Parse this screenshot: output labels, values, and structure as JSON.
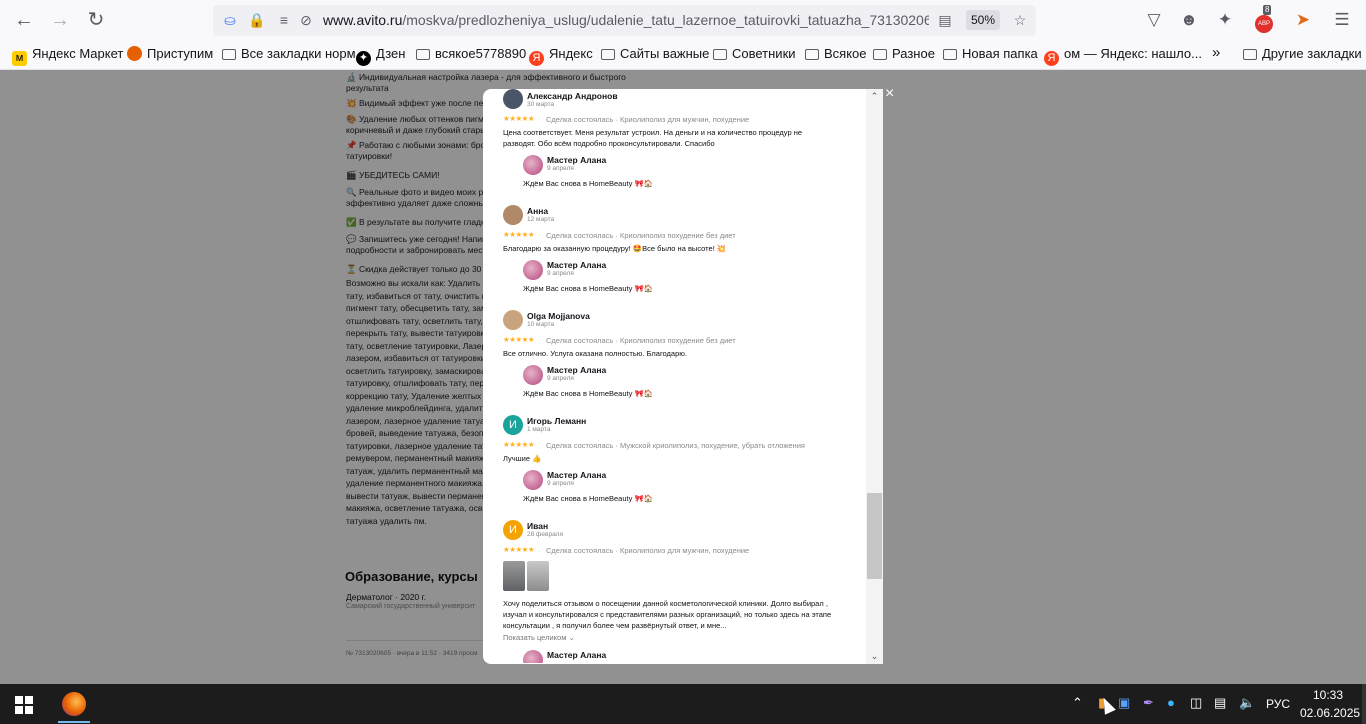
{
  "browser": {
    "url_host": "www.avito.ru",
    "url_path": "/moskva/predlozheniya_uslug/udalenie_tatu_lazernoe_tatuirovki_tatuazha_7313020605",
    "zoom": "50%",
    "notification_badge": "8",
    "badge_text": "ABP"
  },
  "bookmarks": [
    {
      "label": "Яндекс Маркет",
      "icon": "yandex-market-icon"
    },
    {
      "label": "Приступим",
      "icon": "firefox-icon"
    },
    {
      "label": "Все закладки норм",
      "icon": "folder-icon"
    },
    {
      "label": "Дзен",
      "icon": "dzen-icon"
    },
    {
      "label": "всякое5778890",
      "icon": "folder-icon"
    },
    {
      "label": "Яндекс",
      "icon": "yandex-icon"
    },
    {
      "label": "Сайты важные",
      "icon": "folder-icon"
    },
    {
      "label": "Советники",
      "icon": "folder-icon"
    },
    {
      "label": "Всякое",
      "icon": "folder-icon"
    },
    {
      "label": "Разное",
      "icon": "folder-icon"
    },
    {
      "label": "Новая папка",
      "icon": "folder-icon"
    },
    {
      "label": "ом — Яндекс: нашло...",
      "icon": "yandex-icon"
    },
    {
      "label": "Другие закладки",
      "icon": "folder-icon"
    }
  ],
  "background_page": {
    "lines": [
      "🔬 Индивидуальная настройка лазера - для эффективного и быстрого",
      "результата",
      "💥 Видимый эффект уже после перв",
      "🎨 Удаление любых оттенков пигме",
      "коричневый и даже глубокий стары",
      "📌 Работаю с любыми зонами: бров",
      "татуировки!",
      "🎬 УБЕДИТЕСЬ САМИ!",
      "🔍 Реальные фото и видео моих раб",
      "эффективно удаляет даже сложный",
      "✅ В результате вы получите гладк",
      "💬 Запишитесь уже сегодня! Напиш",
      "подробности и забронировать мест",
      "⏳ Скидка действует только до 30 ап",
      "Возможно вы искали как: Удалить та",
      "тату, избавиться от тату, очистить к",
      "пигмент тату, обесцветить тату, зам",
      "отшлифовать тату, осветлить тату, у",
      "перекрыть тату, вывести татуировк",
      "тату, осветление татуировки, Лазер",
      "лазером, избавиться от татуировки",
      "осветлить татуировку, замаскирова",
      "татуировку, отшлифовать тату, пере",
      "коррекцию тату, Удаление желтых б",
      "удаление микроблейдинга, удалить",
      "лазером, лазерное удаление татуа",
      "бровей, выведение татуажа, безопа",
      "татуировки, лазерное удаление тат",
      "ремувером, перманентный макияж",
      "татуаж, удалить перманентный мак",
      "удаление перманентного макияжа,",
      "вывести татуаж, вывести перманен",
      "макияжа, осветление татуажа, осв",
      "татуажа удалить пм."
    ],
    "education_heading": "Образование, курсы",
    "education_item": "Дерматолог · 2020 г.",
    "education_school": "Самарский государственный университ",
    "footer": "№ 7313020605 · вчера в 11:52 · 3419 просм"
  },
  "reviews": [
    {
      "name": "Александр Андронов",
      "date": "30 марта",
      "stars": "★★★★★",
      "deal": "Сделка состоялась · Криолиполиз для мужчин, похудение",
      "text": "Цена соответствует. Меня результат устроил. На деньги и на количество процедур не разводят. Обо всём подробно проконсультировали. Спасибо",
      "avatar": "",
      "avatar_color": "#4a5568"
    },
    {
      "name": "Анна",
      "date": "12 марта",
      "stars": "★★★★★",
      "deal": "Сделка состоялась · Криолиполиз похудение без диет",
      "text": "Благодарю за оказанную процедуру! 🤩Все было на высоте! 💥",
      "avatar": "",
      "avatar_color": "#b08968"
    },
    {
      "name": "Olga Mojjanova",
      "date": "10 марта",
      "stars": "★★★★★",
      "deal": "Сделка состоялась · Криолиполиз похудение без диет",
      "text": "Все отлично. Услуга оказана полностью. Благодарю.",
      "avatar": "",
      "avatar_color": "#c9a27e"
    },
    {
      "name": "Игорь Леманн",
      "date": "1 марта",
      "stars": "★★★★★",
      "deal": "Сделка состоялась · Мужской криолиполиз, похудение, убрать отложения",
      "text": "Лучшие 👍",
      "avatar": "И",
      "avatar_color": "#1aa39a"
    },
    {
      "name": "Иван",
      "date": "28 февраля",
      "stars": "★★★★★",
      "deal": "Сделка состоялась · Криолиполиз для мужчин, похудение",
      "text": "Хочу поделиться отзывом о посещении данной косметологической клиники. Долго выбирал , изучал и консультировался с представителями разных организаций, но только здесь на этапе консультации , я получил более чем развёрнутый ответ, и мне...",
      "avatar": "И",
      "avatar_color": "#f5a300"
    }
  ],
  "reply": {
    "name": "Мастер Алана",
    "date": "9 апреля",
    "text": "Ждём Вас снова в HomeBeauty 🎀🏠"
  },
  "show_more": "Показать целиком ⌄",
  "close_symbol": "×",
  "taskbar": {
    "language": "РУС",
    "time": "10:33",
    "date": "02.06.2025"
  }
}
